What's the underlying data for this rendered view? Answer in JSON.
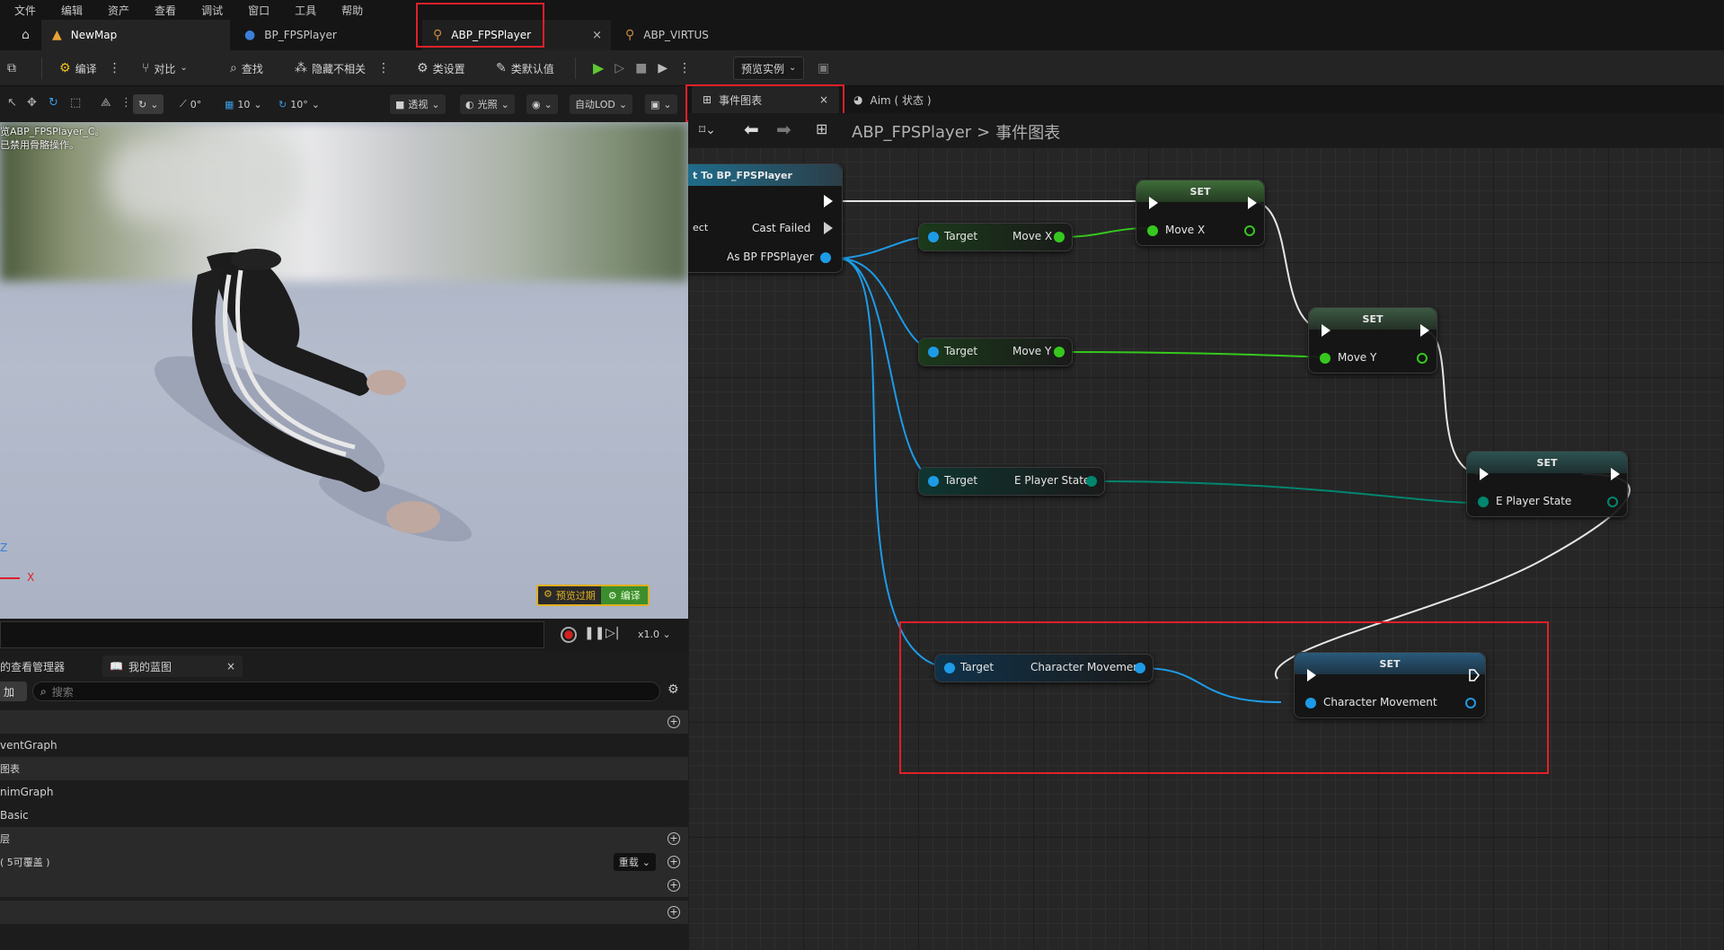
{
  "menu": [
    "文件",
    "编辑",
    "资产",
    "查看",
    "调试",
    "窗口",
    "工具",
    "帮助"
  ],
  "tabs": [
    {
      "label": "NewMap"
    },
    {
      "label": "BP_FPSPlayer"
    },
    {
      "label": "ABP_FPSPlayer"
    },
    {
      "label": "ABP_VIRTUS"
    }
  ],
  "toolbar": {
    "compile": "编译",
    "diff": "对比",
    "find": "查找",
    "hide_unrelated": "隐藏不相关",
    "class_settings": "类设置",
    "class_defaults": "类默认值",
    "preview_instance": "预览实例"
  },
  "viewport_toolbar": {
    "snap_angle": "0°",
    "grid": "10",
    "rotate": "10°",
    "perspective": "透视",
    "lighting": "光照",
    "lod": "自动LOD"
  },
  "viewport": {
    "line1": "览ABP_FPSPlayer_C。",
    "line2": "已禁用骨骼操作。",
    "axis_x": "X",
    "axis_z": "Z",
    "preview_outdated": "预览过期",
    "compile_btn": "编译"
  },
  "timeline": {
    "speed": "x1.0"
  },
  "left_panel": {
    "tab1": "的查看管理器",
    "tab2": "我的蓝图",
    "add": "加",
    "search_placeholder": "搜索",
    "rows": [
      "ventGraph",
      "图表",
      "nimGraph",
      "Basic",
      "层",
      "( 5可覆盖 )"
    ],
    "override": "重载"
  },
  "graph_tabs": {
    "event_graph": "事件图表",
    "aim": "Aim ( 状态 )"
  },
  "breadcrumb": {
    "root": "ABP_FPSPlayer",
    "sep": ">",
    "current": "事件图表"
  },
  "nodes": {
    "cast_title": "t To BP_FPSPlayer",
    "cast_object": "ect",
    "cast_failed": "Cast Failed",
    "cast_as": "As BP FPSPlayer",
    "target": "Target",
    "move_x": "Move X",
    "move_y": "Move Y",
    "e_player_state": "E Player State",
    "character_movement": "Character Movement",
    "set": "SET"
  },
  "colors": {
    "accent_red": "#e0202a",
    "pin_blue": "#1e9be6",
    "pin_green": "#36c81e",
    "pin_teal": "#00866f"
  }
}
